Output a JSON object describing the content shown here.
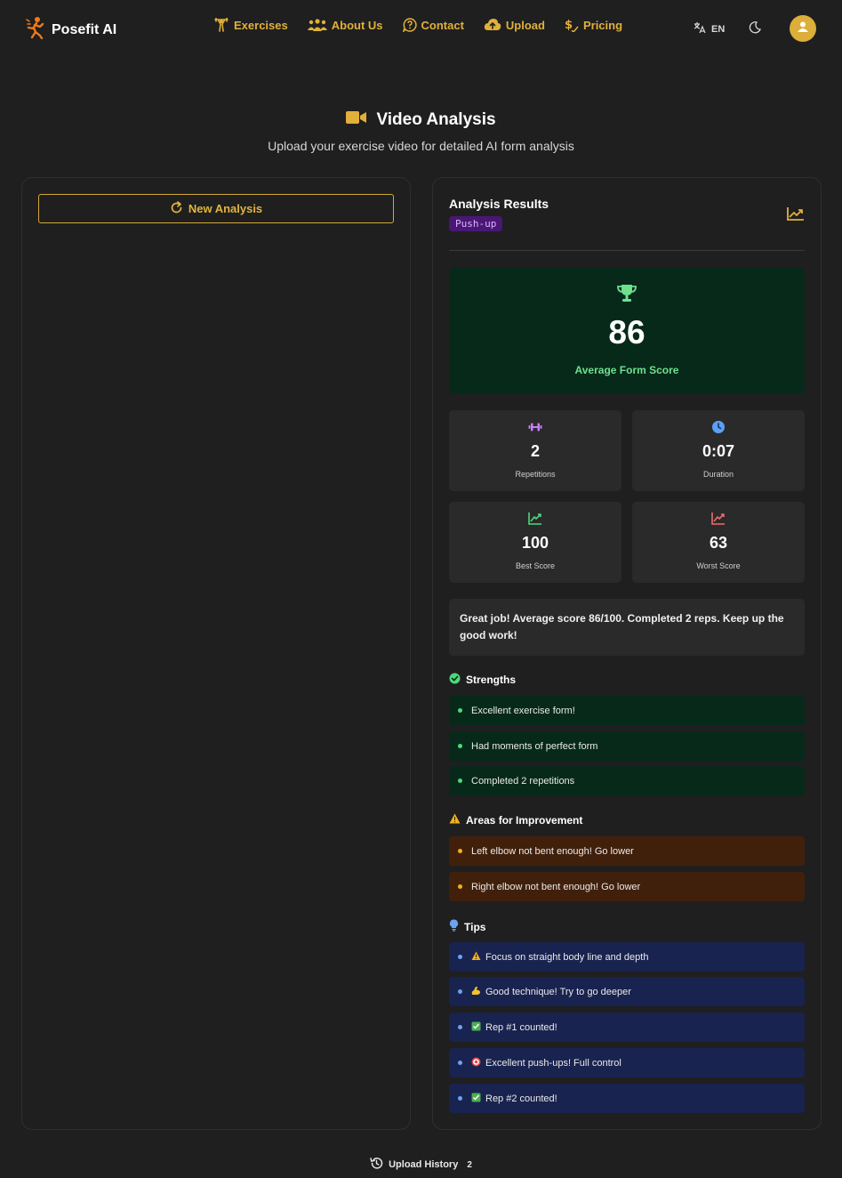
{
  "app": {
    "name": "Posefit AI"
  },
  "nav": {
    "links": [
      {
        "label": "Exercises",
        "icon": "weightlifter-icon"
      },
      {
        "label": "About Us",
        "icon": "users-icon"
      },
      {
        "label": "Contact",
        "icon": "help-circle-icon"
      },
      {
        "label": "Upload",
        "icon": "cloud-upload-icon"
      },
      {
        "label": "Pricing",
        "icon": "dollar-icon"
      }
    ],
    "language": "EN"
  },
  "page": {
    "title": "Video Analysis",
    "subtitle": "Upload your exercise video for detailed AI form analysis"
  },
  "left": {
    "new_analysis_label": "New Analysis"
  },
  "results": {
    "title": "Analysis Results",
    "exercise_badge": "Push-up",
    "average_score": "86",
    "average_score_label": "Average Form Score",
    "stats": [
      {
        "value": "2",
        "label": "Repetitions"
      },
      {
        "value": "0:07",
        "label": "Duration"
      },
      {
        "value": "100",
        "label": "Best Score"
      },
      {
        "value": "63",
        "label": "Worst Score"
      }
    ],
    "summary": "Great job! Average score 86/100. Completed 2 reps. Keep up the good work!",
    "strengths_title": "Strengths",
    "strengths": [
      "Excellent exercise form!",
      "Had moments of perfect form",
      "Completed 2 repetitions"
    ],
    "improvement_title": "Areas for Improvement",
    "improvements": [
      "Left elbow not bent enough! Go lower",
      "Right elbow not bent enough! Go lower"
    ],
    "tips_title": "Tips",
    "tips": [
      "Focus on straight body line and depth",
      "Good technique! Try to go deeper",
      "Rep #1 counted!",
      "Excellent push-ups! Full control",
      "Rep #2 counted!"
    ]
  },
  "footer": {
    "history_label": "Upload History",
    "history_count": "2"
  },
  "colors": {
    "accent": "#e0b03a",
    "background": "#1f1f1f",
    "success_bg": "#06291a",
    "warning_bg": "#41200b",
    "tip_bg": "#19234f"
  }
}
